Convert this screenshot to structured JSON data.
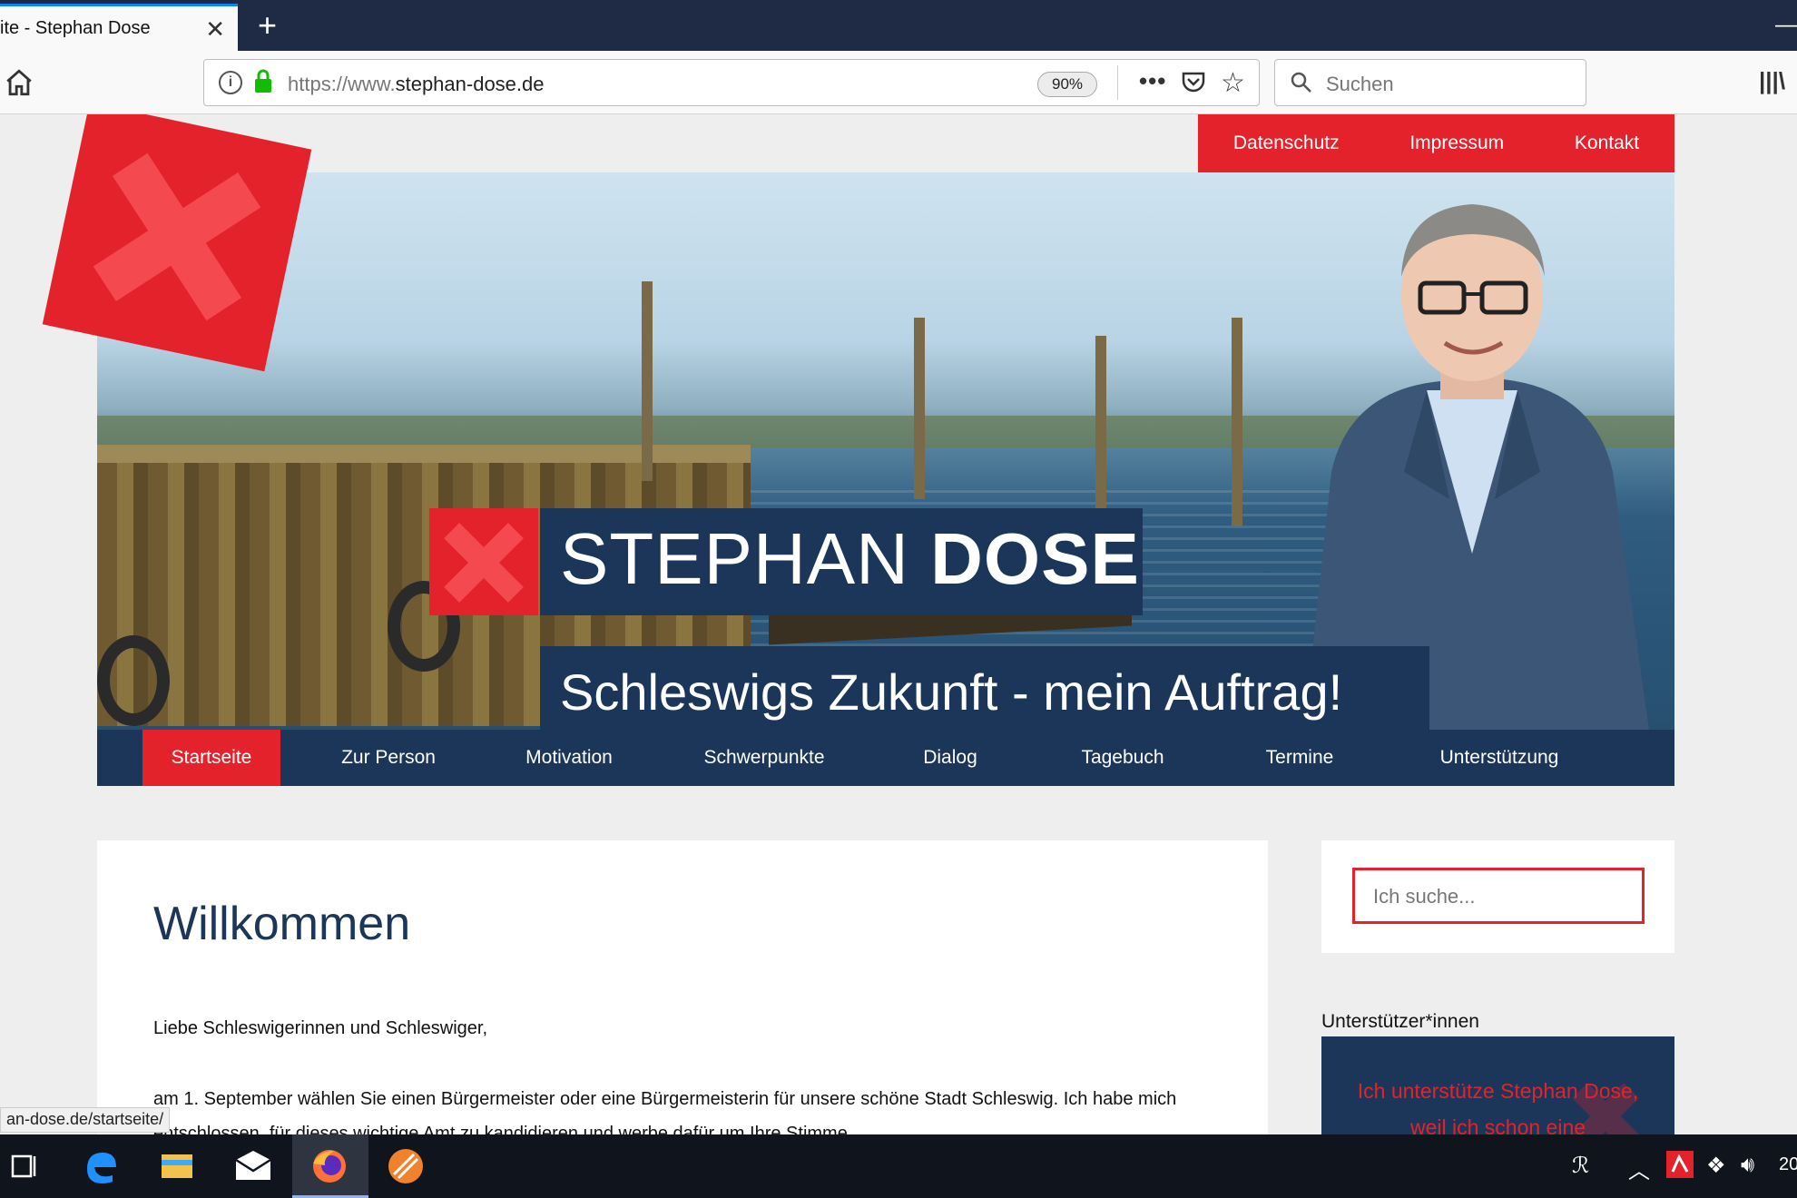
{
  "browser": {
    "tab_title": "ite - Stephan Dose",
    "tab_close": "✕",
    "new_tab": "+",
    "url_scheme": "https://www.",
    "url_host": "stephan-dose.de",
    "zoom": "90%",
    "more": "•••",
    "search_placeholder": "Suchen",
    "library": "|||\\"
  },
  "site": {
    "top_menu": [
      "Datenschutz",
      "Impressum",
      "Kontakt"
    ],
    "title_first": "STEPHAN ",
    "title_bold": "DOSE",
    "slogan": "Schleswigs Zukunft - mein Auftrag!",
    "nav": [
      "Startseite",
      "Zur Person",
      "Motivation",
      "Schwerpunkte",
      "Dialog",
      "Tagebuch",
      "Termine",
      "Unterstützung"
    ],
    "nav_active": "Startseite",
    "heading": "Willkommen",
    "greeting": "Liebe Schleswigerinnen und Schleswiger,",
    "paragraph": "am 1. September wählen Sie einen Bürgermeister oder eine Bürgermeisterin für unsere schöne Stadt Schleswig. Ich habe mich entschlossen, für dieses wichtige Amt zu kandidieren und werbe dafür um Ihre Stimme.",
    "sidebar_search_placeholder": "Ich suche...",
    "supporters_heading": "Unterstützer*innen",
    "supporter_quote": "Ich unterstütze Stephan Dose, weil ich schon eine"
  },
  "status_url": "an-dose.de/startseite/",
  "taskbar": {
    "clock": "20"
  },
  "colors": {
    "brand_red": "#e4222c",
    "brand_navy": "#1b3658"
  }
}
